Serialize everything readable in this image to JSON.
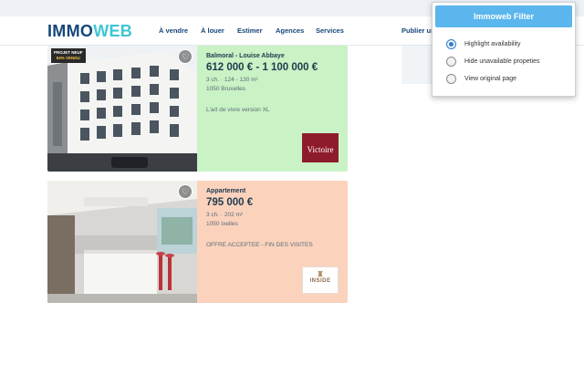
{
  "header": {
    "logo_part1": "IMMO",
    "logo_part2": "WEB",
    "nav": [
      "À vendre",
      "À louer",
      "Estimer",
      "Agences",
      "Services",
      "Publier un"
    ]
  },
  "listings": [
    {
      "badge_line1": "PROJET NEUF",
      "badge_line2": "84% VENDU",
      "type": "Balmoral - Louise Abbaye",
      "price": "612 000 € - 1 100 000 €",
      "specs": "3 ch. · 124 - 130 m²",
      "location": "1050 Bruxelles",
      "description": "L'art de vivre version XL",
      "agency": "Victoire"
    },
    {
      "type": "Appartement",
      "price": "795 000 €",
      "specs": "3 ch. · 202 m²",
      "location": "1050 Ixelles",
      "description": "OFFRE ACCEPTEE - FIN DES VISITES",
      "agency": "INSIDE"
    }
  ],
  "popup": {
    "title": "Immoweb Filter",
    "options": [
      {
        "label": "Highlight availability",
        "checked": true
      },
      {
        "label": "Hide unavailable propeties",
        "checked": false
      },
      {
        "label": "View original page",
        "checked": false
      }
    ]
  },
  "colors": {
    "available_card": "#c9f2c5",
    "unavailable_card": "#fbd3bd",
    "popup_button": "#5ab6ec"
  }
}
